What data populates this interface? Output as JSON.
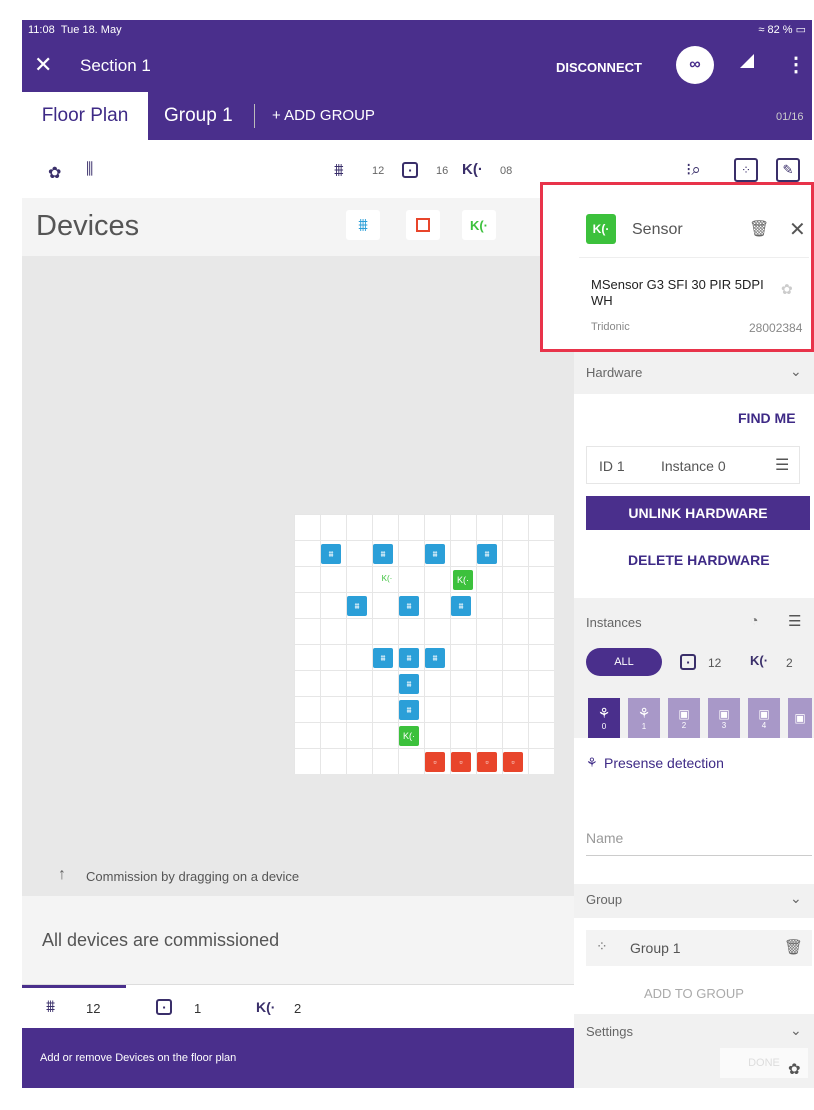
{
  "status": {
    "time": "11:08",
    "date": "Tue 18. May",
    "battery": "82 %"
  },
  "header": {
    "title": "Section 1",
    "disconnect": "DISCONNECT"
  },
  "tabs": {
    "floor_plan": "Floor Plan",
    "group1": "Group 1",
    "add_group": "+ ADD GROUP",
    "page": "01/16"
  },
  "toolbar": {
    "lights_count": "12",
    "io_count": "16",
    "sensor_count": "08"
  },
  "devices": {
    "title": "Devices",
    "hint": "Commission by dragging on a device",
    "commissioned": "All devices are commissioned"
  },
  "bottom_counts": {
    "lights": "12",
    "io": "1",
    "sensors": "2"
  },
  "footer": {
    "text": "Add or remove Devices on the floor plan"
  },
  "panel": {
    "sensor_label": "Sensor",
    "product": "MSensor G3 SFI 30 PIR 5DPI WH",
    "manufacturer": "Tridonic",
    "article": "28002384",
    "hardware": "Hardware",
    "find_me": "FIND ME",
    "id": "ID 1",
    "instance": "Instance 0",
    "unlink": "UNLINK HARDWARE",
    "delete": "DELETE HARDWARE",
    "instances": "Instances",
    "all": "ALL",
    "io_count": "12",
    "sensor_count": "2",
    "instance_nums": [
      "0",
      "1",
      "2",
      "3",
      "4"
    ],
    "presence": "Presense detection",
    "name_placeholder": "Name",
    "group": "Group",
    "group1": "Group 1",
    "add_to_group": "ADD TO GROUP",
    "settings": "Settings",
    "done": "DONE"
  },
  "colors": {
    "primary": "#4a2f8c",
    "accent_red": "#e8334a",
    "light_blue": "#2b9fd8",
    "sensor_green": "#3cc13c",
    "io_red": "#e8452b"
  }
}
